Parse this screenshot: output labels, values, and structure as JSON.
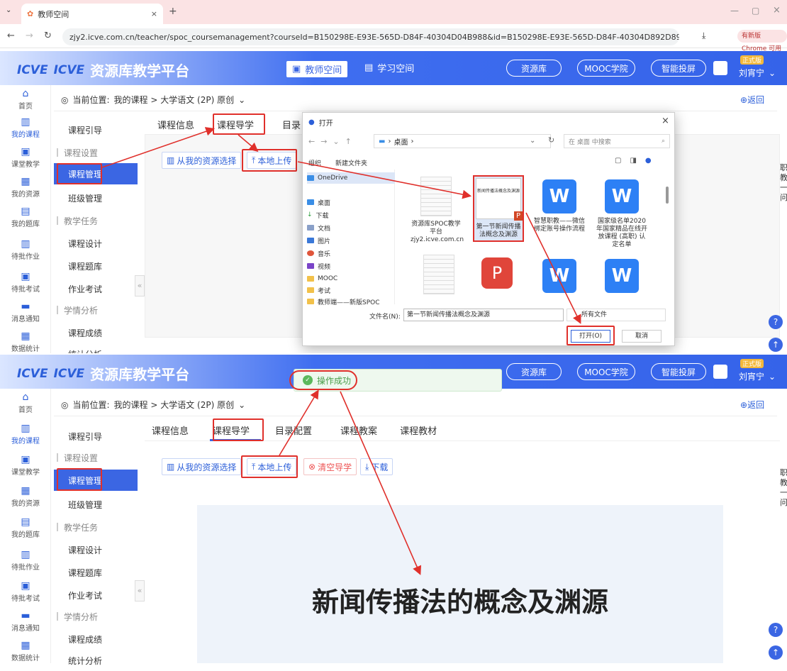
{
  "browser": {
    "tab_title": "教师空间",
    "url": "zjy2.icve.com.cn/teacher/spoc_coursemanagement?courseId=B150298E-E93E-565D-D84F-40304D04B988&id=B150298E-E93E-565D-D84F-40304D892D89&...",
    "update_label": "有新版 Chrome 可用"
  },
  "header": {
    "platform_name": "资源库教学平台",
    "teacher_space": "教师空间",
    "learning_space": "学习空间",
    "resource_lib": "资源库",
    "mooc": "MOOC学院",
    "screen": "智能投屏",
    "badge": "正式版",
    "user": "刘宵宁"
  },
  "leftnav": [
    "首页",
    "我的课程",
    "课堂教学",
    "我的资源",
    "我的题库",
    "待批作业",
    "待批考试",
    "消息通知",
    "数据统计"
  ],
  "breadcrumb": {
    "prefix": "当前位置:",
    "path": "我的课程 > 大学语文 (2P) 原创",
    "back": "返回"
  },
  "sidebar": {
    "guide": "课程引导",
    "set": "课程设置",
    "manage": "课程管理",
    "class": "班级管理",
    "task": "教学任务",
    "design": "课程设计",
    "bank": "课程题库",
    "exam": "作业考试",
    "analysis": "学情分析",
    "score": "课程成绩",
    "stat": "统计分析"
  },
  "tabs": {
    "info": "课程信息",
    "guide": "课程导学",
    "catalog_short": "目录",
    "catalog": "目录配置",
    "plan": "课程教案",
    "material": "课程教材"
  },
  "buttons": {
    "from_resource": "从我的资源选择",
    "local_upload": "本地上传",
    "clear": "清空导学",
    "download": "下载"
  },
  "dialog": {
    "title": "打开",
    "path": "桌面",
    "search_placeholder": "在 桌面 中搜索",
    "organize": "组织",
    "new_folder": "新建文件夹",
    "nav": [
      "OneDrive",
      "桌面",
      "下载",
      "文档",
      "图片",
      "音乐",
      "视频",
      "MOOC",
      "考试",
      "教师端——新版SPOC"
    ],
    "files": [
      "资源库SPOC教学平台 zjy2.icve.com.cn",
      "第一节新闻传播法概念及渊源",
      "智慧职教——微信绑定账号操作流程",
      "国家级名单2020年国家精品在线开放课程 (高职) 认定名单"
    ],
    "thumb_title": "新闻传播法概念及渊源",
    "filename_label": "文件名(N):",
    "filename": "第一节新闻传播法概念及渊源",
    "filetype": "所有文件",
    "open": "打开(O)",
    "cancel": "取消"
  },
  "toast": "操作成功",
  "slide_title": "新闻传播法的概念及渊源",
  "right_edge": [
    "职",
    "教",
    "一",
    "问"
  ],
  "colors": {
    "accent": "#3b66e3",
    "highlight": "#e0302b"
  }
}
